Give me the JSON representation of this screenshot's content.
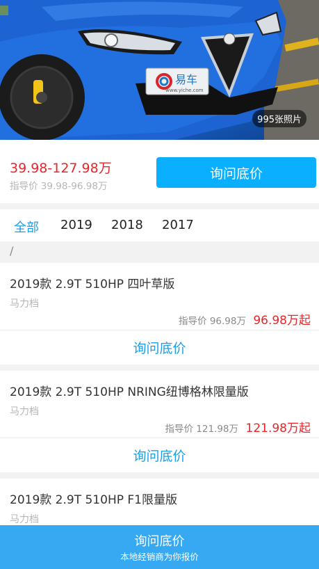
{
  "hero": {
    "photo_count": "995张照片",
    "plate_brand": "易车",
    "plate_url": "www.yiche.com"
  },
  "price": {
    "range": "39.98-127.98万",
    "guide": "指导价 39.98-96.98万",
    "inquiry_button": "询问底价"
  },
  "year_tabs": [
    "全部",
    "2019",
    "2018",
    "2017"
  ],
  "active_tab": "全部",
  "engine_group": "/",
  "trims": [
    {
      "name": "2019款 2.9T 510HP 四叶草版",
      "transmission": "马力档",
      "guide_price": "指导价 96.98万",
      "price": "96.98万起",
      "inquiry": "询问底价"
    },
    {
      "name": "2019款 2.9T 510HP NRING纽博格林限量版",
      "transmission": "马力档",
      "guide_price": "指导价 121.98万",
      "price": "121.98万起",
      "inquiry": "询问底价"
    },
    {
      "name": "2019款 2.9T 510HP F1限量版",
      "transmission": "马力档"
    }
  ],
  "bottom_bar": {
    "title": "询问底价",
    "subtitle": "本地经销商为你报价"
  },
  "colors": {
    "price_red": "#e8262a",
    "accent_blue": "#1a9fe6",
    "button_blue": "#0ab0ff",
    "bottom_bar_blue": "#37a8f2"
  }
}
